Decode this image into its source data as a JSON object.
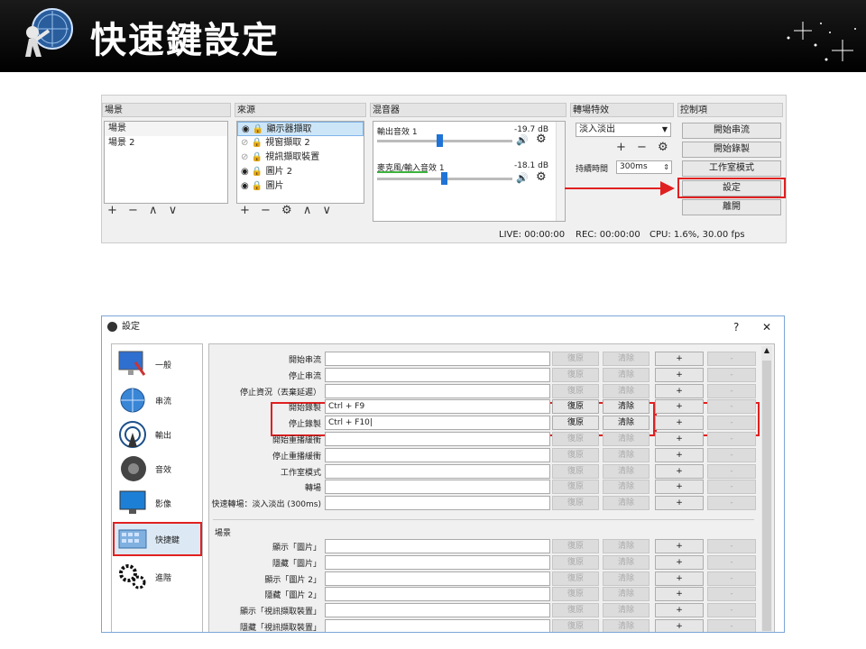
{
  "header": {
    "title": "快速鍵設定"
  },
  "obs": {
    "docks": {
      "scenes": "場景",
      "sources": "來源",
      "mixer": "混音器",
      "transitions": "轉場特效",
      "controls": "控制項"
    },
    "scenes": [
      "場景",
      "場景 2"
    ],
    "sources": [
      "顯示器擷取",
      "視窗擷取 2",
      "視訊擷取裝置",
      "圖片 2",
      "圖片"
    ],
    "mixer": [
      {
        "name": "輸出音效 1",
        "db": "-19.7 dB"
      },
      {
        "name": "麥克風/輸入音效 1",
        "db": "-18.1 dB"
      }
    ],
    "transition": {
      "selected": "淡入淡出",
      "duration_label": "持續時間",
      "duration_value": "300ms"
    },
    "controls": [
      "開始串流",
      "開始錄製",
      "工作室模式",
      "設定",
      "離開"
    ],
    "status": {
      "live": "LIVE: 00:00:00",
      "rec": "REC: 00:00:00",
      "cpu": "CPU: 1.6%, 30.00 fps"
    },
    "scene_toolbar": "+ − ∧ ∨",
    "source_toolbar": "+ − ⚙ ∧ ∨",
    "transition_toolbar": "+ − ⚙"
  },
  "settings": {
    "title": "設定",
    "help": "?",
    "close": "✕",
    "nav": [
      "一般",
      "串流",
      "輸出",
      "音效",
      "影像",
      "快捷鍵",
      "進階"
    ],
    "hotkeys": [
      {
        "label": "開始串流",
        "value": "",
        "active": false
      },
      {
        "label": "停止串流",
        "value": "",
        "active": false
      },
      {
        "label": "停止資況（丟棄延遲）",
        "value": "",
        "active": false
      },
      {
        "label": "開始錄製",
        "value": "Ctrl + F9",
        "active": true
      },
      {
        "label": "停止錄製",
        "value": "Ctrl + F10|",
        "active": true
      },
      {
        "label": "開始重播緩衝",
        "value": "",
        "active": false
      },
      {
        "label": "停止重播緩衝",
        "value": "",
        "active": false
      },
      {
        "label": "工作室模式",
        "value": "",
        "active": false
      },
      {
        "label": "轉場",
        "value": "",
        "active": false
      },
      {
        "label": "快速轉場：淡入淡出 (300ms)",
        "value": "",
        "active": false
      }
    ],
    "scene_section": "場景",
    "scene_hotkeys": [
      {
        "label": "顯示「圖片」",
        "value": ""
      },
      {
        "label": "隱藏「圖片」",
        "value": ""
      },
      {
        "label": "顯示「圖片 2」",
        "value": ""
      },
      {
        "label": "隱藏「圖片 2」",
        "value": ""
      },
      {
        "label": "顯示「視訊擷取裝置」",
        "value": ""
      },
      {
        "label": "隱藏「視訊擷取裝置」",
        "value": ""
      }
    ],
    "buttons": {
      "revert": "復原",
      "clear": "清除",
      "add": "+",
      "remove": "-"
    }
  }
}
